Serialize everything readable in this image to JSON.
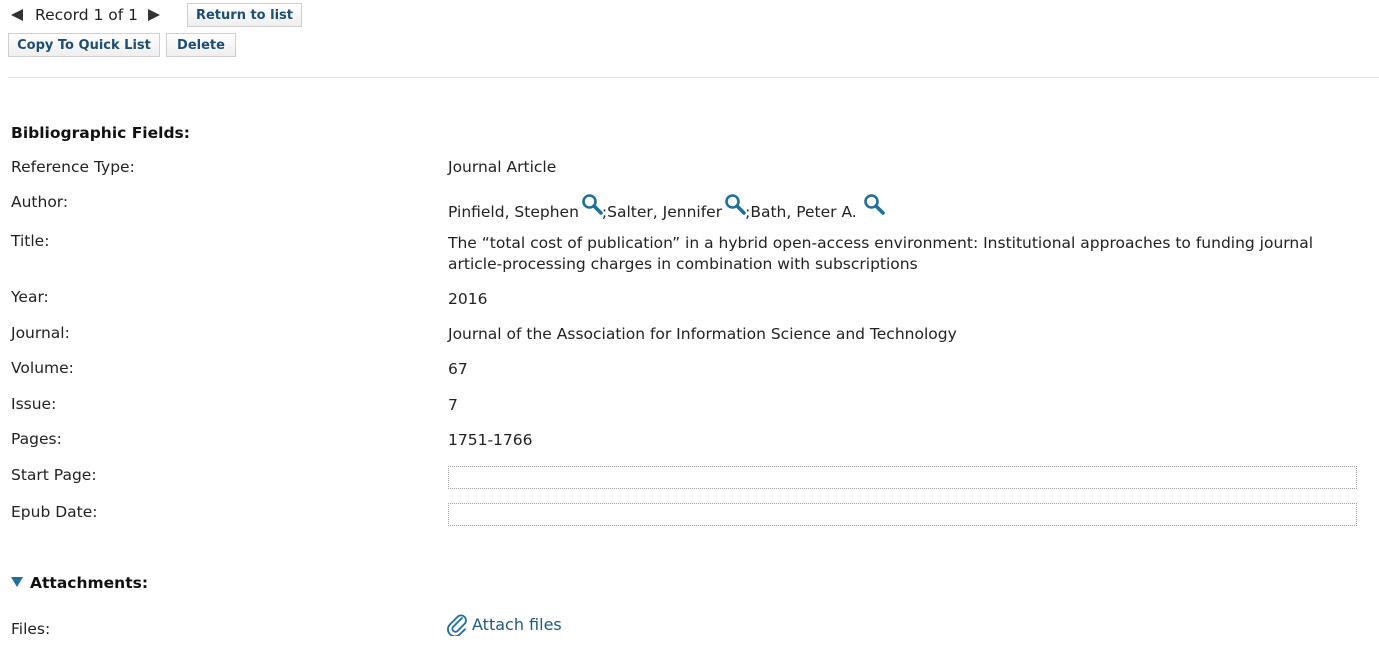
{
  "navigation": {
    "record_label": "Record 1 of 1",
    "return_label": "Return to list"
  },
  "toolbar": {
    "copy_label": "Copy To Quick List",
    "delete_label": "Delete"
  },
  "bibliographic": {
    "heading": "Bibliographic Fields:",
    "fields": {
      "reference_type": {
        "label": "Reference Type:",
        "value": "Journal Article"
      },
      "author": {
        "label": "Author:",
        "authors": [
          {
            "name": "Pinfield, Stephen",
            "icon": "search-icon"
          },
          {
            "name": "Salter, Jennifer",
            "icon": "search-icon"
          },
          {
            "name": "Bath, Peter A.",
            "icon": "search-icon"
          }
        ],
        "separator": ";"
      },
      "title": {
        "label": "Title:",
        "line1": "The “total cost of publication” in a hybrid open-access environment: Institutional approaches to funding journal",
        "line2": "article-processing charges in combination with subscriptions"
      },
      "year": {
        "label": "Year:",
        "value": "2016"
      },
      "journal": {
        "label": "Journal:",
        "value": "Journal of the Association for Information Science and Technology"
      },
      "volume": {
        "label": "Volume:",
        "value": "67"
      },
      "issue": {
        "label": "Issue:",
        "value": "7"
      },
      "pages": {
        "label": "Pages:",
        "value": "1751-1766"
      },
      "start_page": {
        "label": "Start Page:",
        "value": ""
      },
      "epub_date": {
        "label": "Epub Date:",
        "value": ""
      }
    }
  },
  "attachments": {
    "heading": "Attachments:",
    "files_label": "Files:",
    "attach_label": "Attach files",
    "icon": "paperclip-icon"
  },
  "colors": {
    "accent": "#1f6f9c",
    "button_text": "#1d4f74",
    "link": "#1d5a82"
  }
}
